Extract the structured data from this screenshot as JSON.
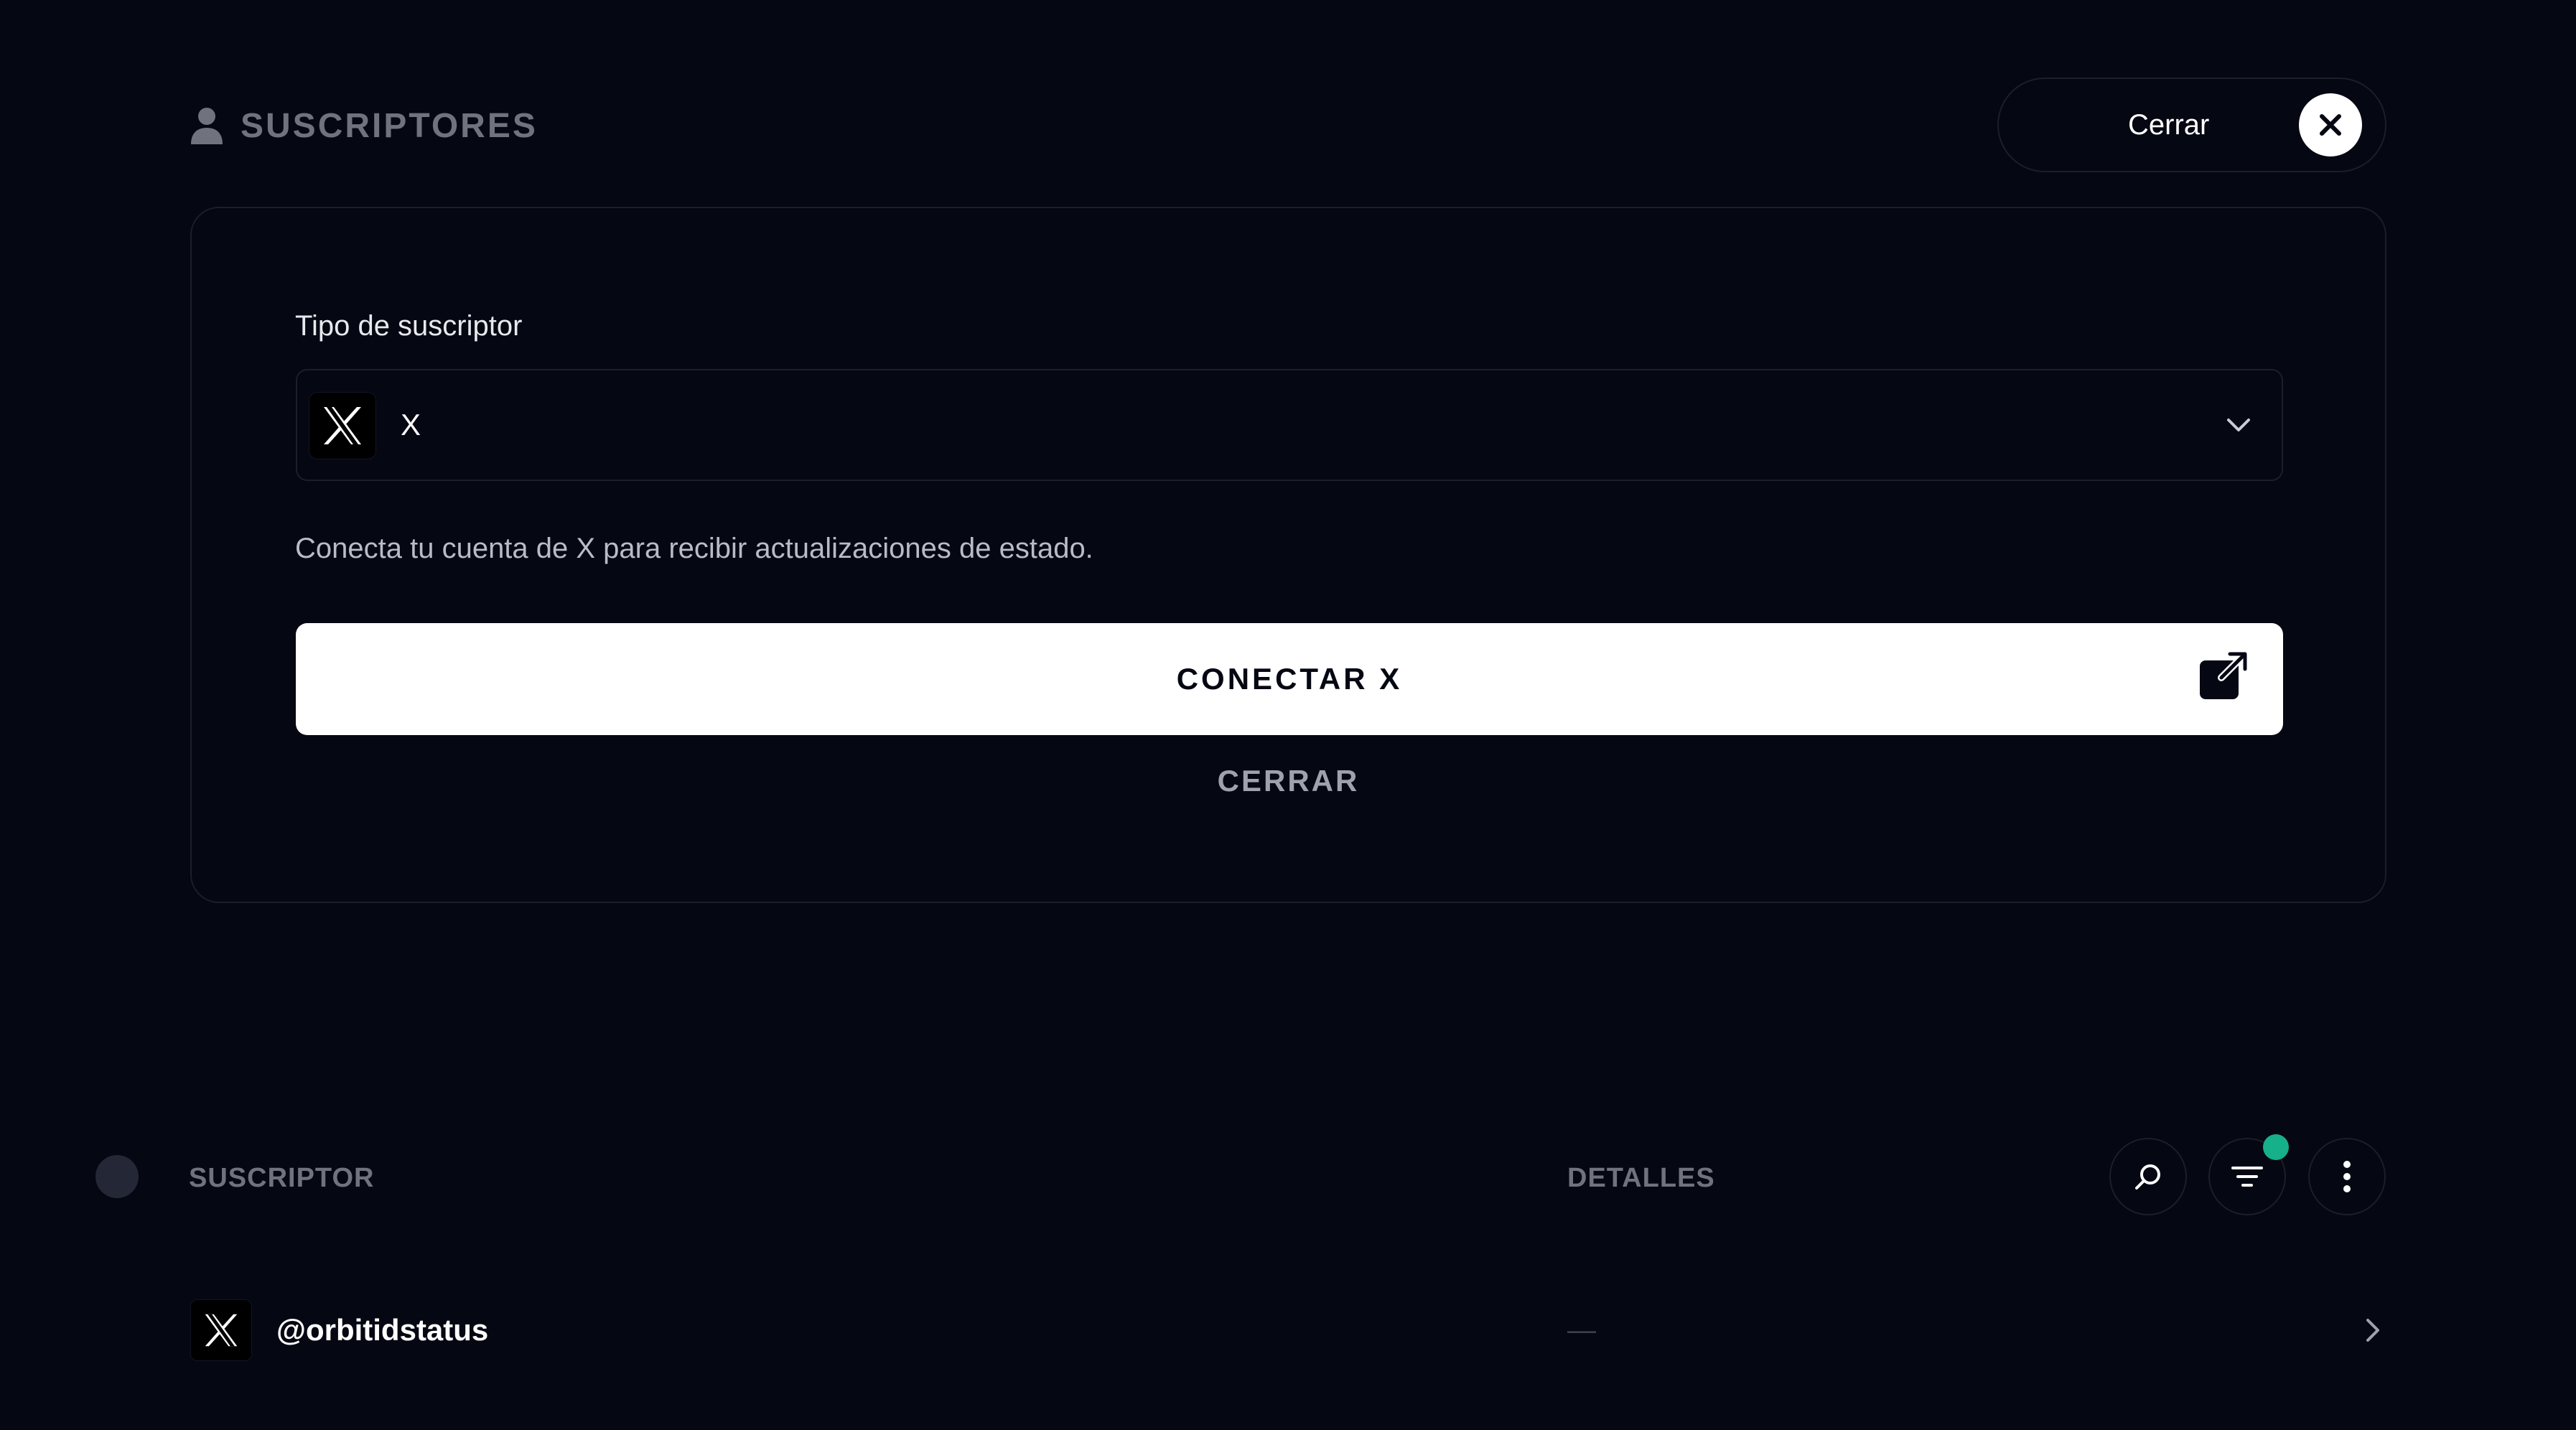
{
  "header": {
    "title": "SUSCRIPTORES",
    "title_icon": "user-icon",
    "close_label": "Cerrar",
    "close_icon": "close-icon"
  },
  "form": {
    "field_label": "Tipo de suscriptor",
    "selected_type": "X",
    "selected_type_icon": "x-logo-icon",
    "description": "Conecta tu cuenta de X para recibir actualizaciones de estado.",
    "connect_label": "CONECTAR X",
    "connect_icon": "external-link-icon",
    "cancel_label": "CERRAR"
  },
  "table": {
    "columns": [
      "SUSCRIPTOR",
      "DETALLES"
    ],
    "toolbar_icons": [
      "search-icon",
      "filter-icon",
      "more-vertical-icon"
    ],
    "filter_active_color": "#16b08a",
    "rows": [
      {
        "handle": "@orbitidstatus",
        "details": "—",
        "icon": "x-logo-icon"
      }
    ]
  },
  "colors": {
    "background": "#050712",
    "border": "#1b1f2b",
    "muted_text": "#6f737e",
    "primary_button": "#ffffff"
  }
}
